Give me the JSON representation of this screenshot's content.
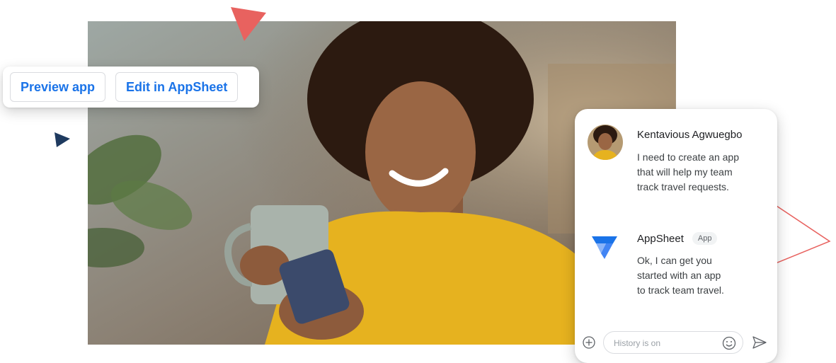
{
  "actions": {
    "preview_label": "Preview app",
    "edit_label": "Edit in AppSheet"
  },
  "chat": {
    "user_message": {
      "sender": "Kentavious Agwuegbo",
      "lines": [
        "I need to create an app",
        "that will help my team",
        "track travel requests."
      ]
    },
    "app_message": {
      "sender": "AppSheet",
      "badge": "App",
      "lines": [
        "Ok, I can get you",
        "started with an app",
        "to track team travel."
      ]
    },
    "input": {
      "placeholder": "History is on",
      "value": ""
    }
  },
  "icons": {
    "add": "add-circle-icon",
    "emoji": "emoji-icon",
    "send": "send-icon",
    "logo": "appsheet-logo-icon"
  },
  "colors": {
    "accent_blue": "#1a73e8",
    "deco_coral": "#e8625f",
    "deco_navy": "#1e3a5f",
    "shirt_yellow": "#e6b21f"
  }
}
